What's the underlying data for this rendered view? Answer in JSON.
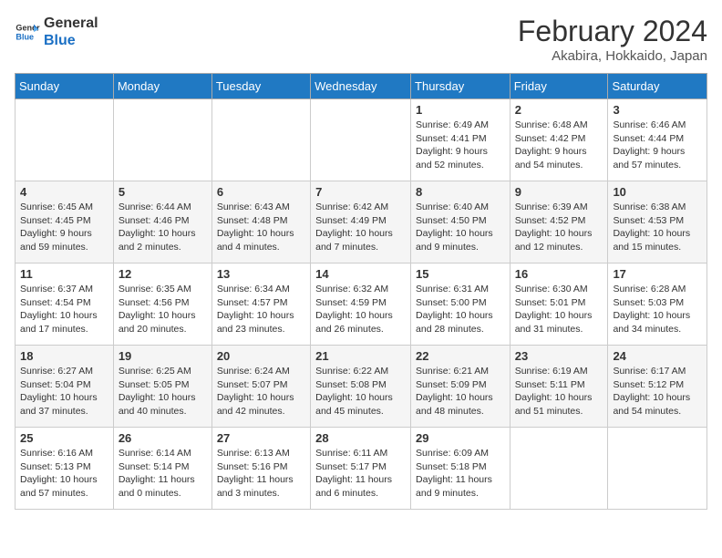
{
  "header": {
    "logo_general": "General",
    "logo_blue": "Blue",
    "title": "February 2024",
    "subtitle": "Akabira, Hokkaido, Japan"
  },
  "days_of_week": [
    "Sunday",
    "Monday",
    "Tuesday",
    "Wednesday",
    "Thursday",
    "Friday",
    "Saturday"
  ],
  "weeks": [
    [
      {
        "day": "",
        "info": ""
      },
      {
        "day": "",
        "info": ""
      },
      {
        "day": "",
        "info": ""
      },
      {
        "day": "",
        "info": ""
      },
      {
        "day": "1",
        "info": "Sunrise: 6:49 AM\nSunset: 4:41 PM\nDaylight: 9 hours and 52 minutes."
      },
      {
        "day": "2",
        "info": "Sunrise: 6:48 AM\nSunset: 4:42 PM\nDaylight: 9 hours and 54 minutes."
      },
      {
        "day": "3",
        "info": "Sunrise: 6:46 AM\nSunset: 4:44 PM\nDaylight: 9 hours and 57 minutes."
      }
    ],
    [
      {
        "day": "4",
        "info": "Sunrise: 6:45 AM\nSunset: 4:45 PM\nDaylight: 9 hours and 59 minutes."
      },
      {
        "day": "5",
        "info": "Sunrise: 6:44 AM\nSunset: 4:46 PM\nDaylight: 10 hours and 2 minutes."
      },
      {
        "day": "6",
        "info": "Sunrise: 6:43 AM\nSunset: 4:48 PM\nDaylight: 10 hours and 4 minutes."
      },
      {
        "day": "7",
        "info": "Sunrise: 6:42 AM\nSunset: 4:49 PM\nDaylight: 10 hours and 7 minutes."
      },
      {
        "day": "8",
        "info": "Sunrise: 6:40 AM\nSunset: 4:50 PM\nDaylight: 10 hours and 9 minutes."
      },
      {
        "day": "9",
        "info": "Sunrise: 6:39 AM\nSunset: 4:52 PM\nDaylight: 10 hours and 12 minutes."
      },
      {
        "day": "10",
        "info": "Sunrise: 6:38 AM\nSunset: 4:53 PM\nDaylight: 10 hours and 15 minutes."
      }
    ],
    [
      {
        "day": "11",
        "info": "Sunrise: 6:37 AM\nSunset: 4:54 PM\nDaylight: 10 hours and 17 minutes."
      },
      {
        "day": "12",
        "info": "Sunrise: 6:35 AM\nSunset: 4:56 PM\nDaylight: 10 hours and 20 minutes."
      },
      {
        "day": "13",
        "info": "Sunrise: 6:34 AM\nSunset: 4:57 PM\nDaylight: 10 hours and 23 minutes."
      },
      {
        "day": "14",
        "info": "Sunrise: 6:32 AM\nSunset: 4:59 PM\nDaylight: 10 hours and 26 minutes."
      },
      {
        "day": "15",
        "info": "Sunrise: 6:31 AM\nSunset: 5:00 PM\nDaylight: 10 hours and 28 minutes."
      },
      {
        "day": "16",
        "info": "Sunrise: 6:30 AM\nSunset: 5:01 PM\nDaylight: 10 hours and 31 minutes."
      },
      {
        "day": "17",
        "info": "Sunrise: 6:28 AM\nSunset: 5:03 PM\nDaylight: 10 hours and 34 minutes."
      }
    ],
    [
      {
        "day": "18",
        "info": "Sunrise: 6:27 AM\nSunset: 5:04 PM\nDaylight: 10 hours and 37 minutes."
      },
      {
        "day": "19",
        "info": "Sunrise: 6:25 AM\nSunset: 5:05 PM\nDaylight: 10 hours and 40 minutes."
      },
      {
        "day": "20",
        "info": "Sunrise: 6:24 AM\nSunset: 5:07 PM\nDaylight: 10 hours and 42 minutes."
      },
      {
        "day": "21",
        "info": "Sunrise: 6:22 AM\nSunset: 5:08 PM\nDaylight: 10 hours and 45 minutes."
      },
      {
        "day": "22",
        "info": "Sunrise: 6:21 AM\nSunset: 5:09 PM\nDaylight: 10 hours and 48 minutes."
      },
      {
        "day": "23",
        "info": "Sunrise: 6:19 AM\nSunset: 5:11 PM\nDaylight: 10 hours and 51 minutes."
      },
      {
        "day": "24",
        "info": "Sunrise: 6:17 AM\nSunset: 5:12 PM\nDaylight: 10 hours and 54 minutes."
      }
    ],
    [
      {
        "day": "25",
        "info": "Sunrise: 6:16 AM\nSunset: 5:13 PM\nDaylight: 10 hours and 57 minutes."
      },
      {
        "day": "26",
        "info": "Sunrise: 6:14 AM\nSunset: 5:14 PM\nDaylight: 11 hours and 0 minutes."
      },
      {
        "day": "27",
        "info": "Sunrise: 6:13 AM\nSunset: 5:16 PM\nDaylight: 11 hours and 3 minutes."
      },
      {
        "day": "28",
        "info": "Sunrise: 6:11 AM\nSunset: 5:17 PM\nDaylight: 11 hours and 6 minutes."
      },
      {
        "day": "29",
        "info": "Sunrise: 6:09 AM\nSunset: 5:18 PM\nDaylight: 11 hours and 9 minutes."
      },
      {
        "day": "",
        "info": ""
      },
      {
        "day": "",
        "info": ""
      }
    ]
  ]
}
